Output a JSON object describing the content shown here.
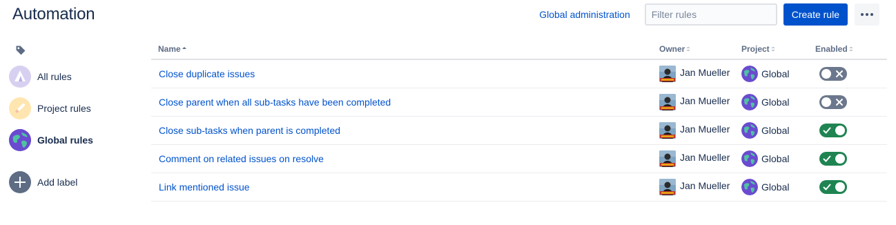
{
  "page": {
    "title": "Automation"
  },
  "header": {
    "global_admin_label": "Global administration",
    "filter_placeholder": "Filter rules",
    "filter_value": "",
    "create_rule_label": "Create rule",
    "more_icon": "more-horizontal-icon"
  },
  "sidebar": {
    "label_icon": "tag-icon",
    "items": [
      {
        "label": "All rules",
        "icon": "atlassian-logo-icon",
        "selected": false
      },
      {
        "label": "Project rules",
        "icon": "pencil-icon",
        "selected": false
      },
      {
        "label": "Global rules",
        "icon": "globe-icon",
        "selected": true
      }
    ],
    "add_label": {
      "label": "Add label",
      "icon": "plus-icon"
    }
  },
  "table": {
    "columns": [
      {
        "label": "Name",
        "sort": "ascending"
      },
      {
        "label": "Owner",
        "sort": "none"
      },
      {
        "label": "Project",
        "sort": "none"
      },
      {
        "label": "Enabled",
        "sort": "none"
      }
    ],
    "rows": [
      {
        "name": "Close duplicate issues",
        "owner": "Jan Mueller",
        "project": "Global",
        "enabled": false
      },
      {
        "name": "Close parent when all sub-tasks have been completed",
        "owner": "Jan Mueller",
        "project": "Global",
        "enabled": false
      },
      {
        "name": "Close sub-tasks when parent is completed",
        "owner": "Jan Mueller",
        "project": "Global",
        "enabled": true
      },
      {
        "name": "Comment on related issues on resolve",
        "owner": "Jan Mueller",
        "project": "Global",
        "enabled": true
      },
      {
        "name": "Link mentioned issue",
        "owner": "Jan Mueller",
        "project": "Global",
        "enabled": true
      }
    ]
  },
  "colors": {
    "link": "#0052cc",
    "primary_button": "#0052cc",
    "toggle_on": "#1f8452",
    "toggle_off": "#6b778c"
  }
}
